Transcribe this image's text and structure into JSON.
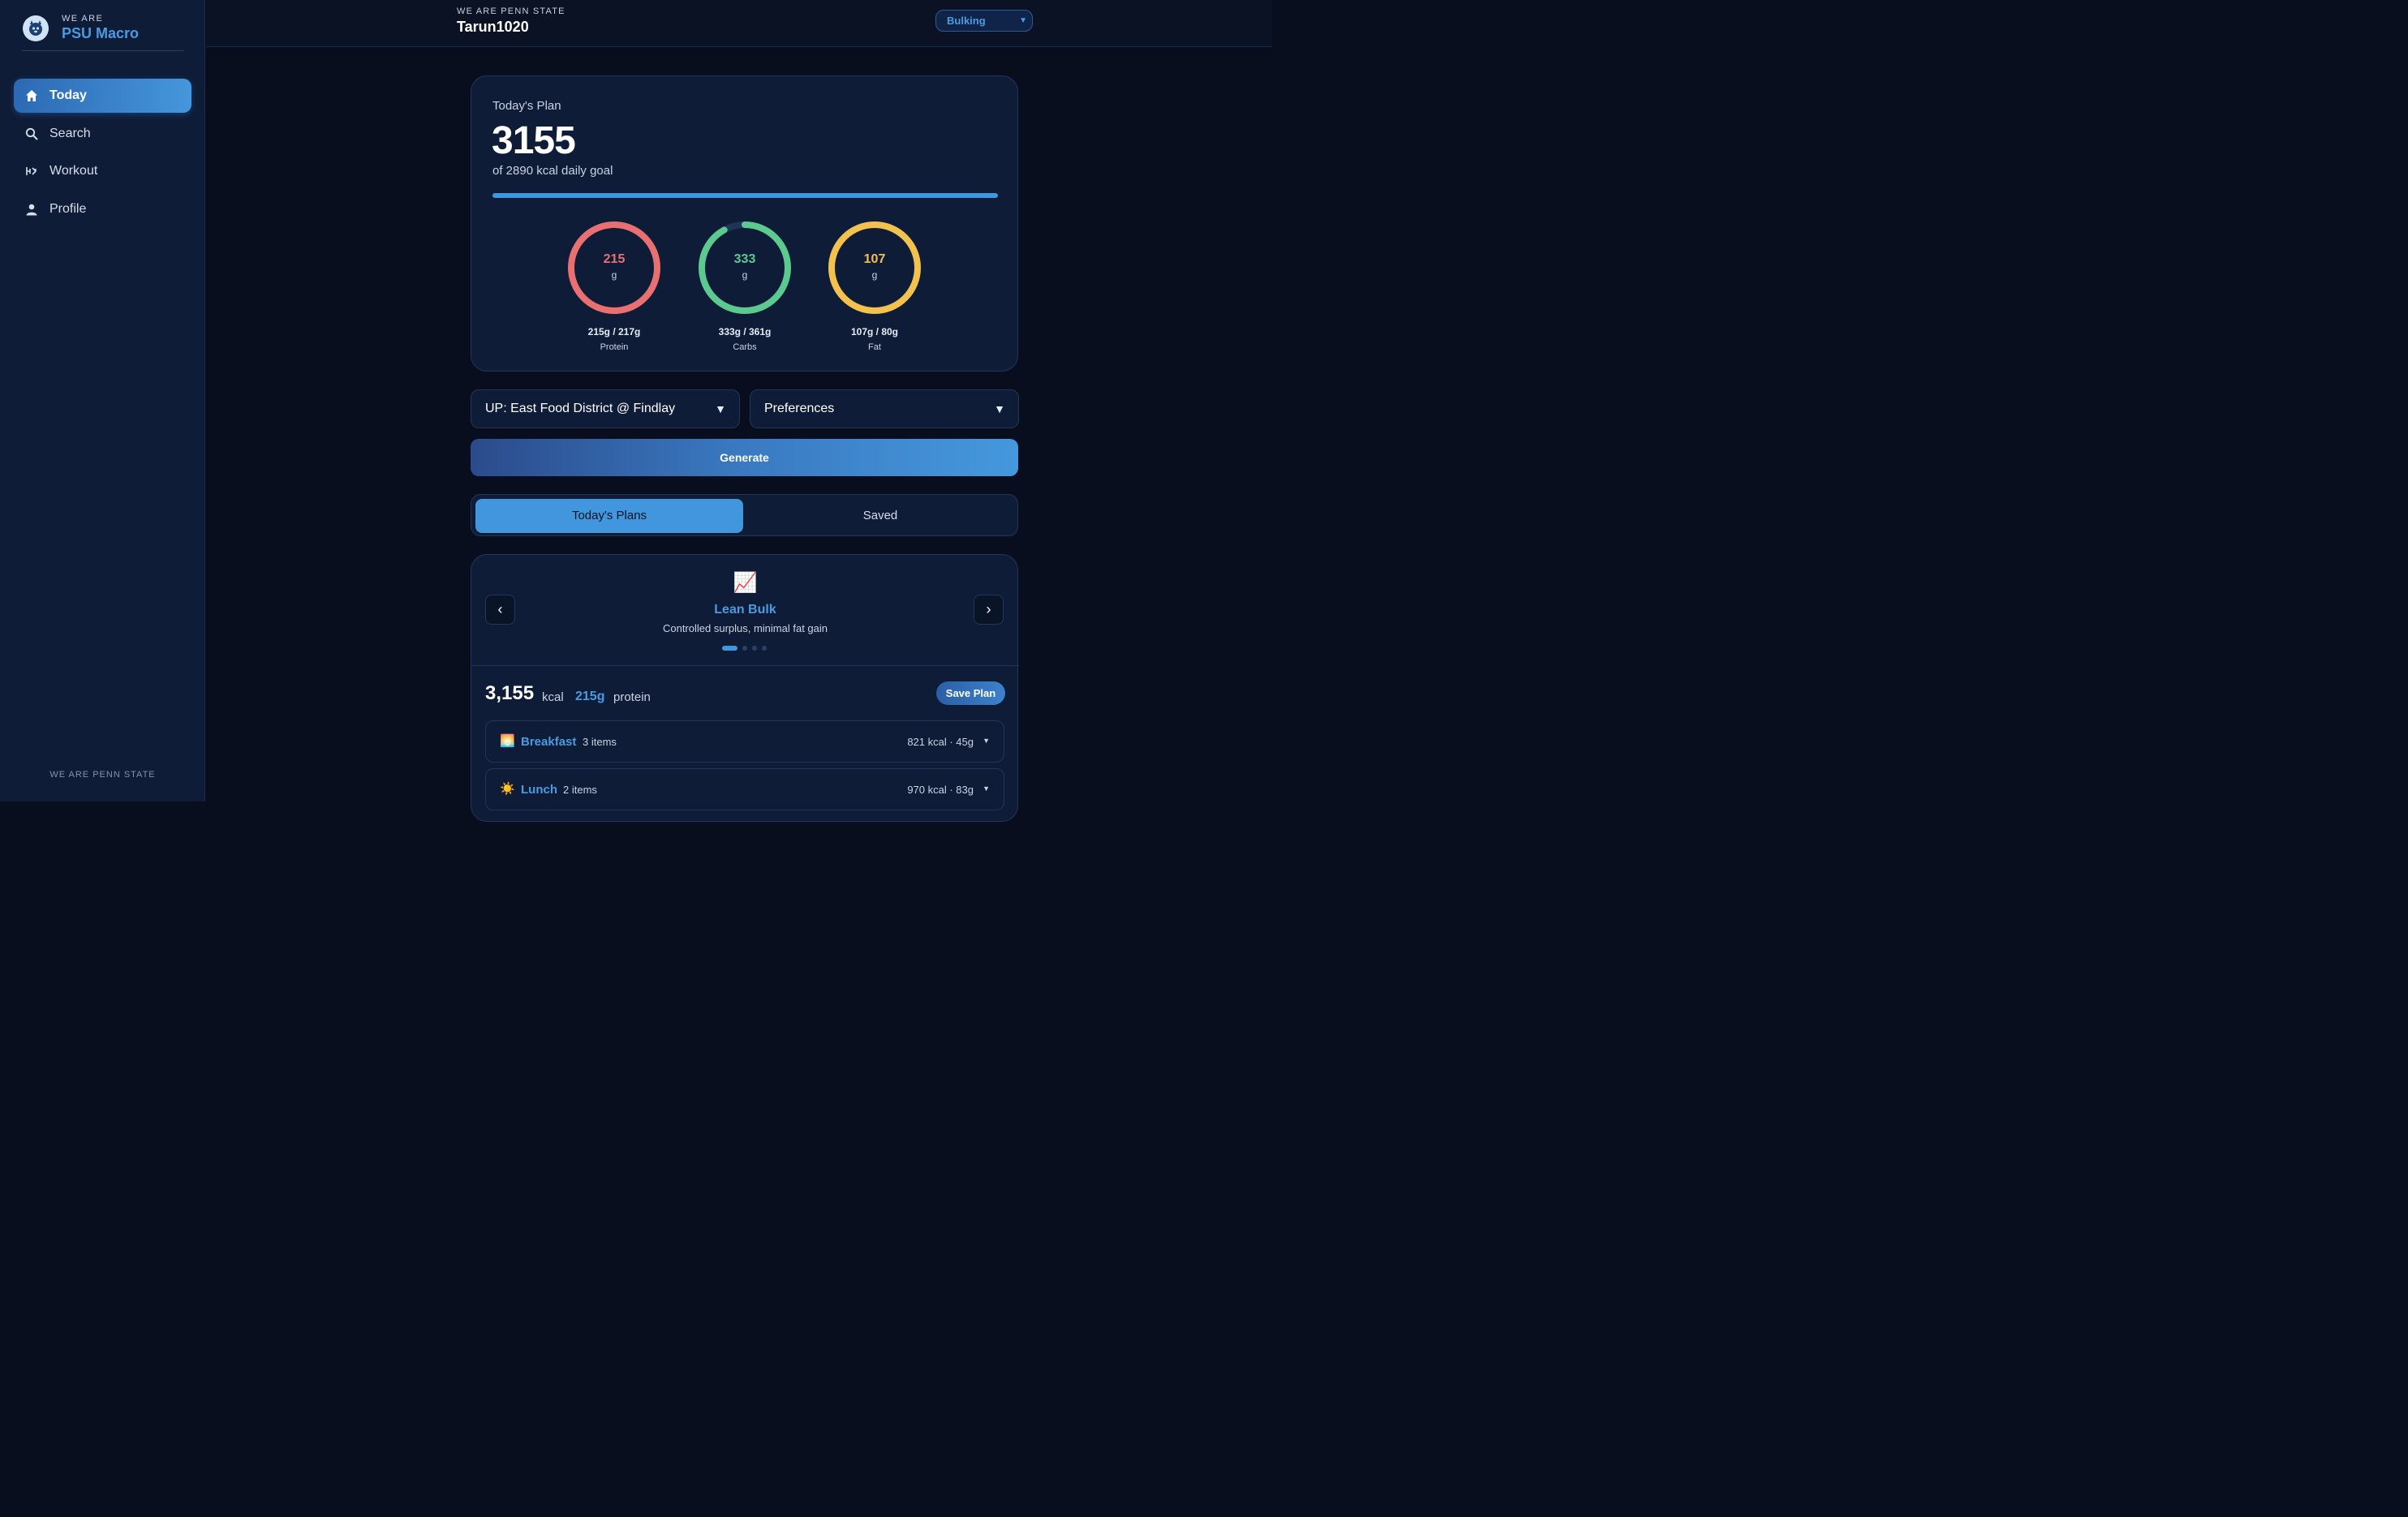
{
  "brand": {
    "small": "WE ARE",
    "name": "PSU Macro"
  },
  "sidebar": {
    "items": [
      {
        "label": "Today",
        "icon": "home-icon"
      },
      {
        "label": "Search",
        "icon": "search-icon"
      },
      {
        "label": "Workout",
        "icon": "workout-icon"
      },
      {
        "label": "Profile",
        "icon": "person-icon"
      }
    ],
    "footer": "WE ARE PENN STATE"
  },
  "header": {
    "subtitle": "WE ARE PENN STATE",
    "username": "Tarun1020",
    "goal_select": "Bulking"
  },
  "plan": {
    "label": "Today's Plan",
    "kcal": "3155",
    "goal_text": "of 2890 kcal daily goal",
    "progress": 1.0,
    "macros": [
      {
        "value": "215",
        "unit": "g",
        "amount": "215g / 217g",
        "name": "Protein",
        "color": "#e87070",
        "fraction": 0.99
      },
      {
        "value": "333",
        "unit": "g",
        "amount": "333g / 361g",
        "name": "Carbs",
        "color": "#5cc98f",
        "fraction": 0.92
      },
      {
        "value": "107",
        "unit": "g",
        "amount": "107g / 80g",
        "name": "Fat",
        "color": "#f2c14e",
        "fraction": 1.0
      }
    ]
  },
  "location_select": "UP: East Food District @ Findlay",
  "preferences_select": "Preferences",
  "generate_label": "Generate",
  "tabs": {
    "plans": "Today's Plans",
    "saved": "Saved"
  },
  "strategy": {
    "emoji": "📈",
    "name": "Lean Bulk",
    "description": "Controlled surplus, minimal fat gain",
    "prev": "‹",
    "next": "›"
  },
  "summary": {
    "kcal": "3,155",
    "kcal_unit": "kcal",
    "protein": "215g",
    "protein_unit": "protein",
    "save_label": "Save Plan"
  },
  "meals": [
    {
      "emoji": "🌅",
      "name": "Breakfast",
      "count": "3 items",
      "stats": "821 kcal · 45g"
    },
    {
      "emoji": "☀️",
      "name": "Lunch",
      "count": "2 items",
      "stats": "970 kcal · 83g"
    }
  ],
  "colors": {
    "accent": "#4196de",
    "background": "#080e1d",
    "card": "#0f1c38"
  }
}
